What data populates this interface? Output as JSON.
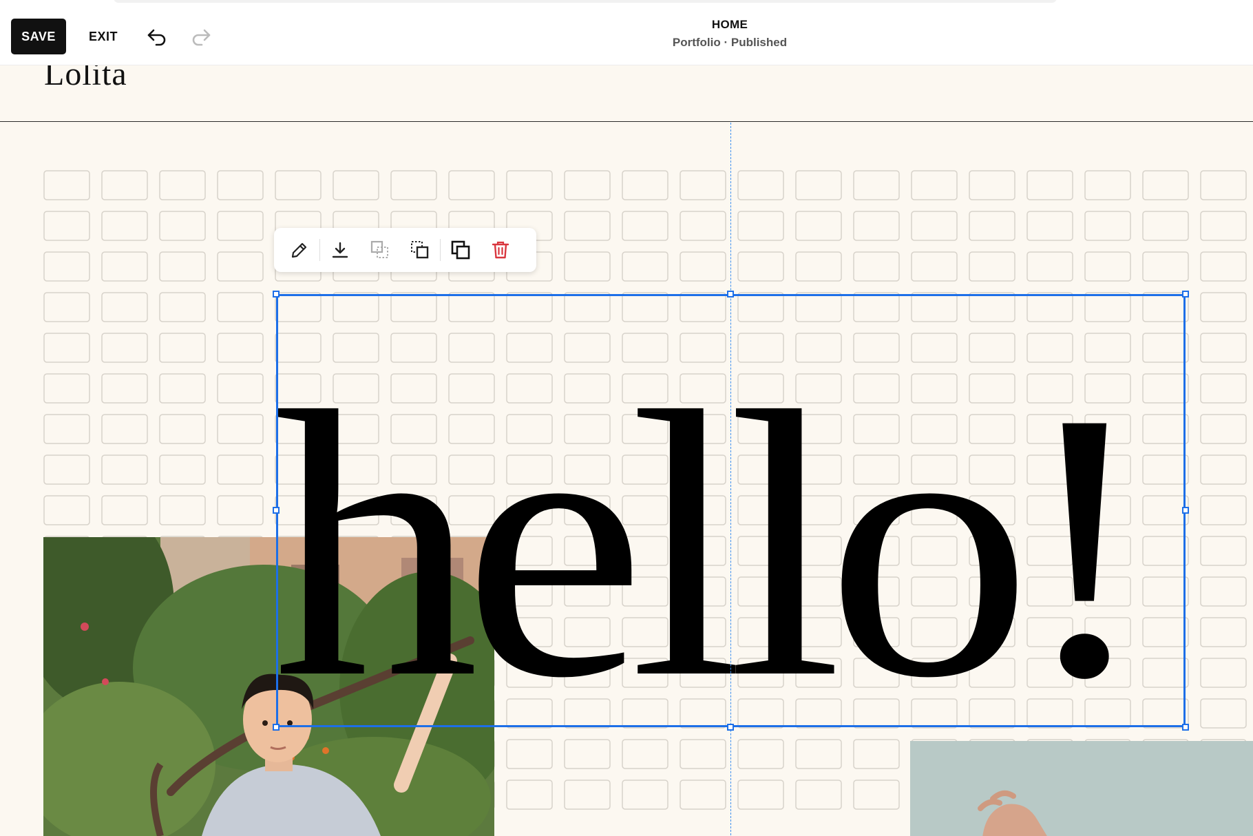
{
  "toolbar": {
    "save_label": "SAVE",
    "exit_label": "EXIT",
    "undo_icon": "undo-icon",
    "redo_icon": "redo-icon"
  },
  "page": {
    "title": "HOME",
    "status": "Portfolio · Published"
  },
  "site": {
    "logo": "Lolita"
  },
  "canvas": {
    "headline": "hello!"
  },
  "block_toolbar": {
    "items": [
      {
        "name": "edit-icon"
      },
      {
        "name": "download-icon"
      },
      {
        "name": "send-backward-icon",
        "disabled": true
      },
      {
        "name": "bring-forward-icon"
      },
      {
        "name": "duplicate-icon"
      },
      {
        "name": "delete-icon",
        "color": "#d9363e"
      }
    ]
  },
  "colors": {
    "accent": "#1d6fe8",
    "canvas_bg": "#fcf8f1",
    "delete": "#d9363e"
  }
}
